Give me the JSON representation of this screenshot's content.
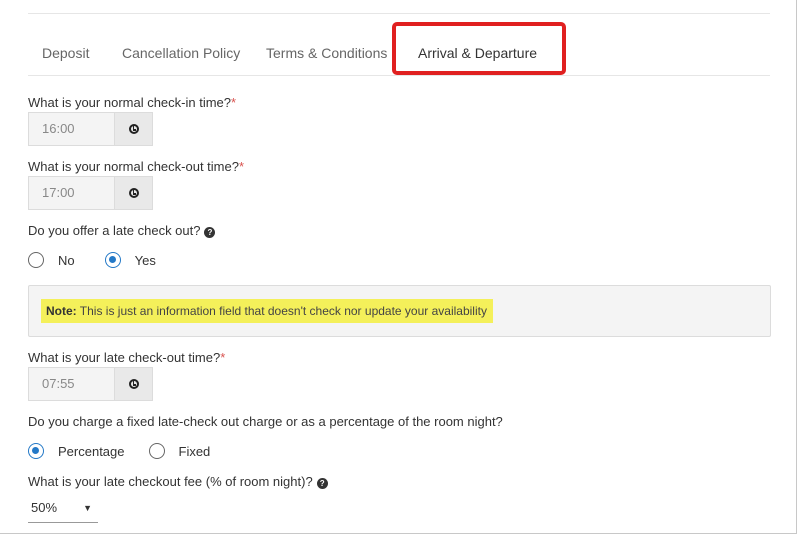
{
  "tabs": [
    {
      "label": "Deposit"
    },
    {
      "label": "Cancellation Policy"
    },
    {
      "label": "Terms & Conditions"
    },
    {
      "label": "Arrival & Departure"
    }
  ],
  "highlight_color": "#e02020",
  "checkin": {
    "label": "What is your normal check-in time?",
    "required": "*",
    "value": "16:00"
  },
  "checkout": {
    "label": "What is your normal check-out time?",
    "required": "*",
    "value": "17:00"
  },
  "late_checkout": {
    "label": "Do you offer a late check out?",
    "help": "?",
    "options": [
      {
        "label": "No"
      },
      {
        "label": "Yes"
      }
    ],
    "selected": "Yes"
  },
  "note": {
    "prefix": "Note:",
    "text": " This is just an information field that doesn't check nor update your availability"
  },
  "late_time": {
    "label": "What is your late check-out time?",
    "required": "*",
    "value": "07:55"
  },
  "charge_type": {
    "label": "Do you charge a fixed late-check out charge or as a percentage of the room night?",
    "options": [
      {
        "label": "Percentage"
      },
      {
        "label": "Fixed"
      }
    ],
    "selected": "Percentage"
  },
  "fee": {
    "label": "What is your late checkout fee (% of room night)?",
    "help": "?",
    "value": "50%",
    "arrow": "▼"
  }
}
